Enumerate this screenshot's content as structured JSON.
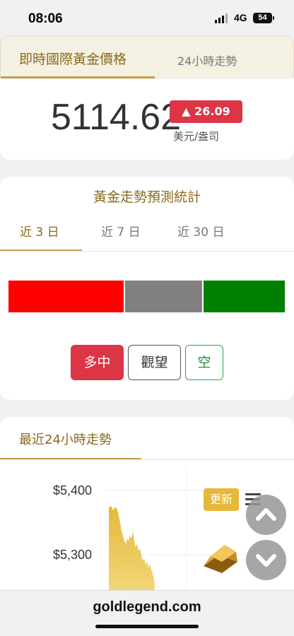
{
  "status_bar": {
    "time": "08:06",
    "network": "4G",
    "battery": "54"
  },
  "top_tabs": {
    "active": "即時國際黃金價格",
    "inactive": "24小時走勢"
  },
  "price": {
    "value": "5114.62",
    "change": "▲ 26.09",
    "change_color": "#dc3545",
    "unit": "美元/盎司"
  },
  "forecast": {
    "title": "黃金走勢預測統計",
    "periods": [
      "近 3 日",
      "近 7 日",
      "近 30 日"
    ],
    "selected_period": "近 3 日",
    "buttons": {
      "long": "多中",
      "watch": "觀望",
      "short": "空"
    },
    "colors": {
      "long": "#ff0000",
      "watch": "#808080",
      "short": "#008000"
    }
  },
  "trend": {
    "title": "最近24小時走勢",
    "y_labels": [
      "$5,400",
      "$5,300"
    ],
    "update_label": "更新",
    "accent": "#e5b838"
  },
  "icons": {
    "menu": "menu-icon",
    "gold_bar": "gold-bar-icon",
    "scroll_up": "chevron-up-icon",
    "scroll_down": "chevron-down-icon"
  },
  "url": "goldlegend.com"
}
